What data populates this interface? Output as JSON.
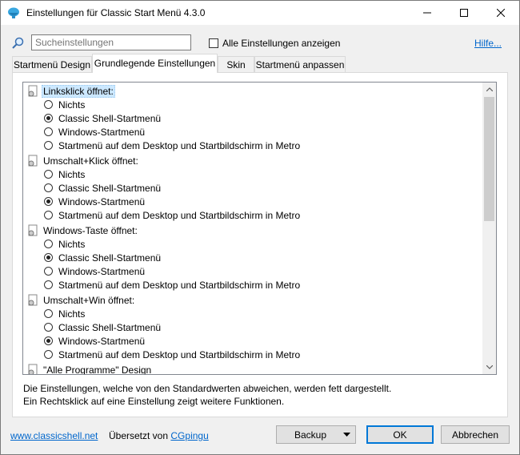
{
  "window": {
    "title": "Einstellungen für Classic Start Menü 4.3.0"
  },
  "search": {
    "placeholder": "Sucheinstellungen",
    "value": ""
  },
  "show_all": {
    "label": "Alle Einstellungen anzeigen",
    "checked": false
  },
  "help": {
    "label": "Hilfe..."
  },
  "tabs": [
    {
      "label": "Startmenü Design"
    },
    {
      "label": "Grundlegende Einstellungen",
      "active": true
    },
    {
      "label": "Skin"
    },
    {
      "label": "Startmenü anpassen"
    }
  ],
  "settings": [
    {
      "label": "Linksklick öffnet:",
      "selected": true,
      "options": [
        "Nichts",
        "Classic Shell-Startmenü",
        "Windows-Startmenü",
        "Startmenü auf dem Desktop und Startbildschirm in Metro"
      ],
      "checked": 1
    },
    {
      "label": "Umschalt+Klick öffnet:",
      "options": [
        "Nichts",
        "Classic Shell-Startmenü",
        "Windows-Startmenü",
        "Startmenü auf dem Desktop und Startbildschirm in Metro"
      ],
      "checked": 2
    },
    {
      "label": "Windows-Taste öffnet:",
      "options": [
        "Nichts",
        "Classic Shell-Startmenü",
        "Windows-Startmenü",
        "Startmenü auf dem Desktop und Startbildschirm in Metro"
      ],
      "checked": 1
    },
    {
      "label": "Umschalt+Win öffnet:",
      "options": [
        "Nichts",
        "Classic Shell-Startmenü",
        "Windows-Startmenü",
        "Startmenü auf dem Desktop und Startbildschirm in Metro"
      ],
      "checked": 2
    },
    {
      "label": "\"Alle Programme\" Design",
      "options": []
    }
  ],
  "info": {
    "line1": "Die Einstellungen, welche von den Standardwerten abweichen, werden fett dargestellt.",
    "line2": "Ein Rechtsklick auf eine Einstellung zeigt weitere Funktionen."
  },
  "footer": {
    "website": "www.classicshell.net",
    "translated_by": "Übersetzt von",
    "translator": "CGpingu",
    "backup": "Backup",
    "ok": "OK",
    "cancel": "Abbrechen"
  },
  "colors": {
    "accent": "#0078d7",
    "link": "#0066cc",
    "selection": "#cce8ff"
  }
}
